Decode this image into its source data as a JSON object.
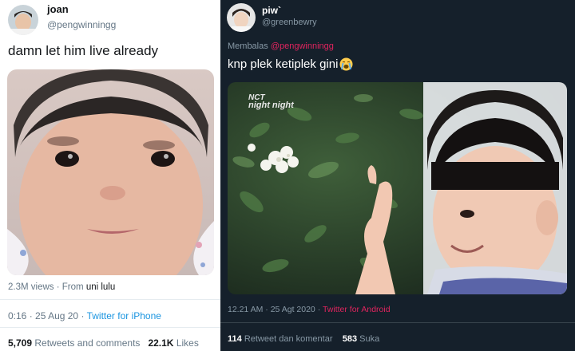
{
  "left_tweet": {
    "name": "joan",
    "handle": "@pengwinningg",
    "text": "damn let him live already",
    "views": "2.3M views",
    "from_label": "From",
    "source": "uni lulu",
    "time": "0:16",
    "date": "25 Aug 20",
    "app": "Twitter for iPhone",
    "retweets_count": "5,709",
    "retweets_label": "Retweets and comments",
    "likes_count": "22.1K",
    "likes_label": "Likes"
  },
  "right_tweet": {
    "name": "piw`",
    "handle": "@greenbewry",
    "reply_prefix": "Membalas",
    "reply_to": "@pengwinningg",
    "text": "knp plek ketiplek gini",
    "emoji": "loudly-crying-face",
    "watermark_line1": "NCT",
    "watermark_line2": "night night",
    "time": "12.21 AM",
    "date": "25 Agt 2020",
    "app": "Twitter for Android",
    "retweets_count": "114",
    "retweets_label": "Retweet dan komentar",
    "likes_count": "583",
    "likes_label": "Suka"
  },
  "colors": {
    "link_blue": "#1b95e0",
    "link_pink": "#e0245e",
    "dark_bg": "#15202b"
  }
}
